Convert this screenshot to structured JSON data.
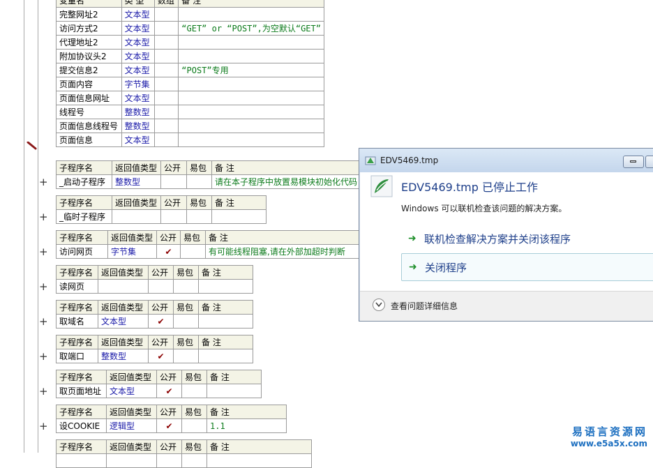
{
  "var_table": {
    "header": [
      "变量名",
      "类 型",
      "数组",
      "备 注"
    ],
    "rows": [
      {
        "name": "完整网址2",
        "type": "文本型",
        "array": "",
        "note": ""
      },
      {
        "name": "访问方式2",
        "type": "文本型",
        "array": "",
        "note": "“GET” or “POST”,为空默认“GET”"
      },
      {
        "name": "代理地址2",
        "type": "文本型",
        "array": "",
        "note": ""
      },
      {
        "name": "附加协议头2",
        "type": "文本型",
        "array": "",
        "note": ""
      },
      {
        "name": "提交信息2",
        "type": "文本型",
        "array": "",
        "note": "“POST”专用"
      },
      {
        "name": "页面内容",
        "type": "字节集",
        "array": "",
        "note": ""
      },
      {
        "name": "页面信息网址",
        "type": "文本型",
        "array": "",
        "note": ""
      },
      {
        "name": "线程号",
        "type": "整数型",
        "array": "",
        "note": ""
      },
      {
        "name": "页面信息线程号",
        "type": "整数型",
        "array": "",
        "note": ""
      },
      {
        "name": "页面信息",
        "type": "文本型",
        "array": "",
        "note": ""
      }
    ]
  },
  "sub_header": [
    "子程序名",
    "返回值类型",
    "公开",
    "易包",
    "备 注"
  ],
  "subs": [
    {
      "name": "_启动子程序",
      "ret": "整数型",
      "public": false,
      "note": "请在本子程序中放置易模块初始化代码"
    },
    {
      "name": "_临时子程序",
      "ret": "",
      "public": false,
      "note": ""
    },
    {
      "name": "访问网页",
      "ret": "字节集",
      "public": true,
      "note": "有可能线程阻塞,请在外部加超时判断"
    },
    {
      "name": "读网页",
      "ret": "",
      "public": false,
      "note": ""
    },
    {
      "name": "取域名",
      "ret": "文本型",
      "public": true,
      "note": ""
    },
    {
      "name": "取端口",
      "ret": "整数型",
      "public": true,
      "note": ""
    },
    {
      "name": "取页面地址",
      "ret": "文本型",
      "public": true,
      "note": ""
    },
    {
      "name": "设COOKIE",
      "ret": "逻辑型",
      "public": true,
      "note": "1.1"
    },
    {
      "name": "",
      "ret": "",
      "public": false,
      "note": ""
    }
  ],
  "check_mark": "✔",
  "dialog": {
    "title": "EDV5469.tmp",
    "heading": "EDV5469.tmp 已停止工作",
    "subtext": "Windows 可以联机检查该问题的解决方案。",
    "option1": "联机检查解决方案并关闭该程序",
    "option2": "关闭程序",
    "footer": "查看问题详细信息",
    "arrow": "➜"
  },
  "watermark": {
    "line1": "易语言资源网",
    "line2": "www.e5a5x.com"
  },
  "colors": {
    "type_blue": "#1a1aa8",
    "note_green": "#0b7a1a",
    "dialog_heading": "#1e3f8a"
  }
}
